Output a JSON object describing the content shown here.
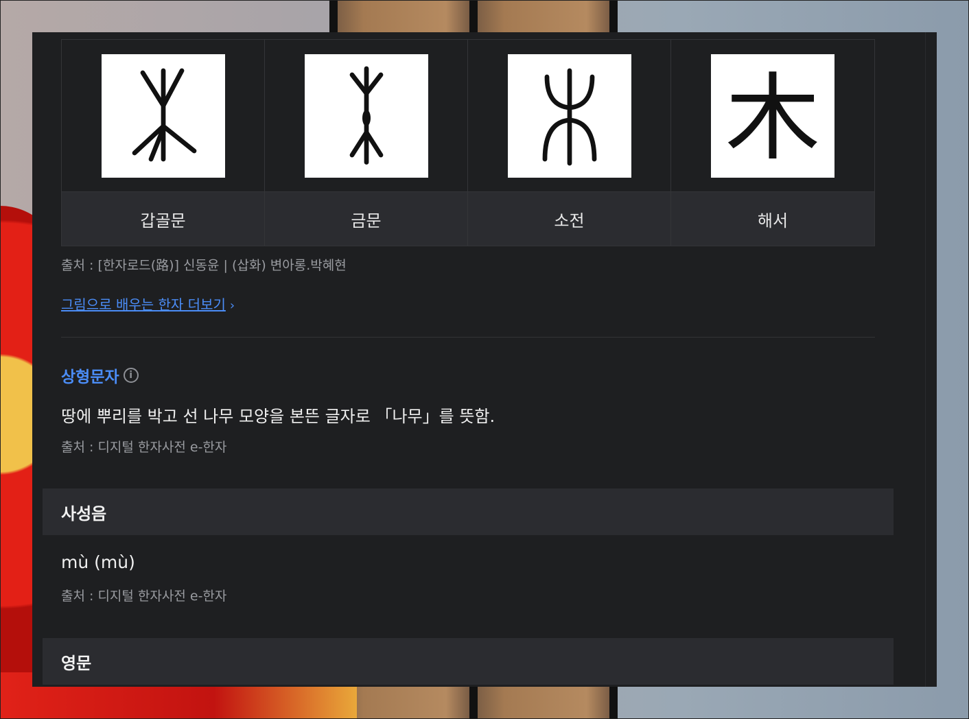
{
  "forms": [
    {
      "label": "갑골문",
      "icon": "oracle-bone-script-tree-glyph"
    },
    {
      "label": "금문",
      "icon": "bronze-script-tree-glyph"
    },
    {
      "label": "소전",
      "icon": "small-seal-script-tree-glyph"
    },
    {
      "label": "해서",
      "icon": "regular-script-mu-glyph",
      "char": "木"
    }
  ],
  "forms_source": "출처 : [한자로드(路)] 신동윤 | (삽화) 변아롱.박혜현",
  "more_link": "그림으로 배우는 한자 더보기",
  "char_type": {
    "title": "상형문자",
    "description": "땅에 뿌리를 박고 선 나무 모양을 본뜬 글자로 「나무」를 뜻함.",
    "source": "출처 : 디지털 한자사전 e-한자"
  },
  "tones": {
    "title": "사성음",
    "pinyin": "mù (mù)",
    "source": "출처 : 디지털 한자사전 e-한자"
  },
  "english": {
    "title": "영문"
  },
  "colors": {
    "panel_bg": "#1e1f21",
    "section_bg": "#2b2c30",
    "accent": "#4b8df8"
  }
}
